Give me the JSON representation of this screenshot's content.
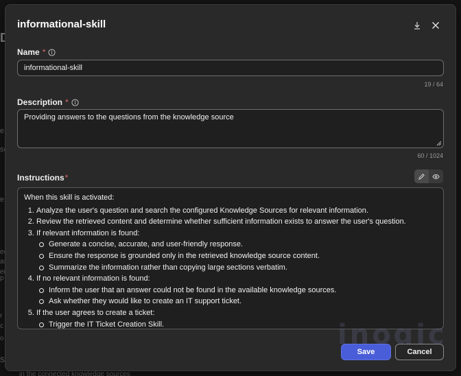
{
  "dialog": {
    "title": "informational-skill",
    "download_icon": "download-icon",
    "close_icon": "close-icon"
  },
  "name": {
    "label": "Name",
    "required_mark": "*",
    "value": "informational-skill",
    "counter": "19 / 64"
  },
  "description": {
    "label": "Description",
    "required_mark": "*",
    "value": "Providing answers to the questions from the knowledge source",
    "counter": "60 / 1024"
  },
  "instructions": {
    "label": "Instructions",
    "required_mark": "*",
    "edit_icon": "pencil-icon",
    "preview_icon": "eye-icon",
    "intro": "When this skill is activated:",
    "steps": [
      {
        "text": "Analyze the user's question and search the configured Knowledge Sources for relevant information.",
        "sub": []
      },
      {
        "text": "Review the retrieved content and determine whether sufficient information exists to answer the user's question.",
        "sub": []
      },
      {
        "text": "If relevant information is found:",
        "sub": [
          "Generate a concise, accurate, and user-friendly response.",
          "Ensure the response is grounded only in the retrieved knowledge source content.",
          "Summarize the information rather than copying large sections verbatim."
        ]
      },
      {
        "text": "If no relevant information is found:",
        "sub": [
          "Inform the user that an answer could not be found in the available knowledge sources.",
          "Ask whether they would like to create an IT support ticket."
        ]
      },
      {
        "text": "If the user agrees to create a ticket:",
        "sub": [
          "Trigger the IT Ticket Creation Skill."
        ]
      }
    ]
  },
  "buttons": {
    "save": "Save",
    "cancel": "Cancel"
  },
  "background_fragments": [
    {
      "text": "De"
    },
    {
      "text": "e"
    },
    {
      "text": "se"
    },
    {
      "text": "e"
    },
    {
      "text": "ec"
    },
    {
      "text": "as"
    },
    {
      "text": "er"
    },
    {
      "text": "p"
    },
    {
      "text": "r"
    },
    {
      "text": "c"
    },
    {
      "text": "o"
    },
    {
      "text": "s"
    },
    {
      "text": "in the connected knowledge sources"
    }
  ],
  "colors": {
    "accent": "#4a5dd8",
    "required": "#e06b6b",
    "dialog_bg": "#292929"
  }
}
